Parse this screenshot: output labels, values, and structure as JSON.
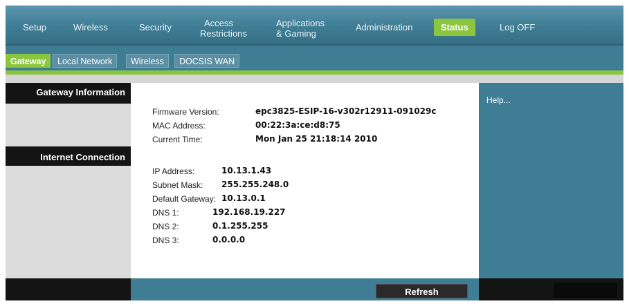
{
  "nav": {
    "setup": "Setup",
    "wireless": "Wireless",
    "security": "Security",
    "access_line1": "Access",
    "access_line2": "Restrictions",
    "apps_line1": "Applications",
    "apps_line2": "& Gaming",
    "administration": "Administration",
    "status": "Status",
    "logoff": "Log OFF"
  },
  "subtabs": {
    "gateway": "Gateway",
    "local_network": "Local Network",
    "wireless": "Wireless",
    "docsis_wan": "DOCSIS WAN"
  },
  "sidebar": {
    "gateway_info": "Gateway Information",
    "internet_connection": "Internet Connection"
  },
  "gateway": {
    "firmware_label": "Firmware Version:",
    "firmware_value": "epc3825-ESIP-16-v302r12911-091029c",
    "mac_label": "MAC Address:",
    "mac_value": "00:22:3a:ce:d8:75",
    "time_label": "Current Time:",
    "time_value": "Mon Jan 25 21:18:14 2010"
  },
  "internet": {
    "ip_label": "IP Address:",
    "ip_value": "10.13.1.43",
    "subnet_label": "Subnet Mask:",
    "subnet_value": "255.255.248.0",
    "gateway_label": "Default Gateway:",
    "gateway_value": "10.13.0.1",
    "dns1_label": "DNS 1:",
    "dns1_value": "192.168.19.227",
    "dns2_label": "DNS 2:",
    "dns2_value": "0.1.255.255",
    "dns3_label": "DNS 3:",
    "dns3_value": "0.0.0.0"
  },
  "help": {
    "label": "Help..."
  },
  "actions": {
    "refresh": "Refresh"
  },
  "colors": {
    "nav_blue": "#3f7d95",
    "active_green": "#8cc63e",
    "sidebar_black": "#141414"
  }
}
